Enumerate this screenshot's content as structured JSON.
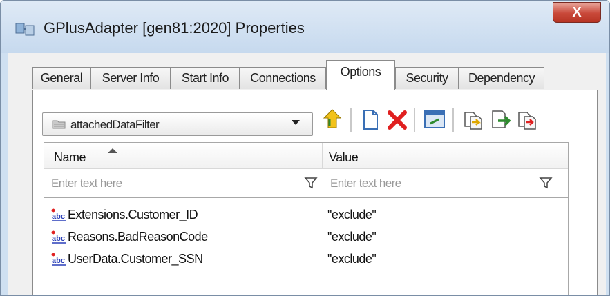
{
  "window": {
    "title": "GPlusAdapter [gen81:2020] Properties",
    "close_label": "X"
  },
  "tabs": [
    {
      "label": "General"
    },
    {
      "label": "Server Info"
    },
    {
      "label": "Start Info"
    },
    {
      "label": "Connections"
    },
    {
      "label": "Options",
      "active": true
    },
    {
      "label": "Security"
    },
    {
      "label": "Dependency"
    }
  ],
  "options": {
    "section_select": {
      "value": "attachedDataFilter"
    },
    "toolbar": [
      {
        "icon": "import-icon"
      },
      {
        "icon": "new-icon"
      },
      {
        "icon": "delete-icon"
      },
      {
        "icon": "edit-icon"
      },
      {
        "icon": "copy-icon"
      },
      {
        "icon": "export-icon"
      },
      {
        "icon": "paste-icon"
      }
    ],
    "grid": {
      "columns": [
        "Name",
        "Value"
      ],
      "filters": {
        "name_placeholder": "Enter text here",
        "value_placeholder": "Enter text here"
      },
      "rows": [
        {
          "name": "Extensions.Customer_ID",
          "value": "\"exclude\""
        },
        {
          "name": "Reasons.BadReasonCode",
          "value": "\"exclude\""
        },
        {
          "name": "UserData.Customer_SSN",
          "value": "\"exclude\""
        }
      ]
    }
  },
  "colors": {
    "title_bar": "#c6d9ee",
    "close_button": "#c9493a",
    "delete_accent": "#e02020",
    "abc_icon": "#2a3fb8"
  }
}
